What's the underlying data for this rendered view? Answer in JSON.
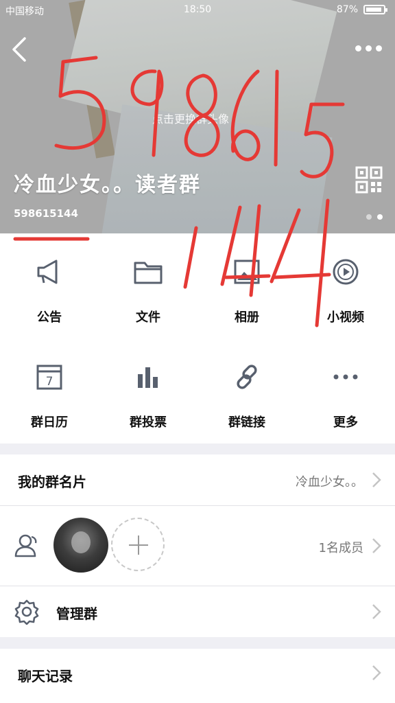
{
  "status_bar": {
    "carrier": "中国移动",
    "time": "18:50",
    "battery": "87%"
  },
  "header": {
    "change_cover": "点击更换群头像",
    "group_name": "冷血少女。。读者群",
    "group_id": "598615144"
  },
  "features": [
    {
      "label": "公告",
      "icon": "megaphone-icon"
    },
    {
      "label": "文件",
      "icon": "folder-icon"
    },
    {
      "label": "相册",
      "icon": "photo-album-icon"
    },
    {
      "label": "小视频",
      "icon": "video-icon"
    },
    {
      "label": "群日历",
      "icon": "calendar-icon",
      "badge": "7"
    },
    {
      "label": "群投票",
      "icon": "bar-chart-icon"
    },
    {
      "label": "群链接",
      "icon": "link-icon"
    },
    {
      "label": "更多",
      "icon": "more-dots-icon"
    }
  ],
  "rows": {
    "my_card": {
      "title": "我的群名片",
      "value": "冷血少女。。"
    },
    "members": {
      "count": "1名成员"
    },
    "manage": {
      "title": "管理群"
    },
    "chat_history": {
      "title": "聊天记录"
    }
  },
  "handwriting": {
    "text": "598615144",
    "color": "#e53935"
  },
  "colors": {
    "icon_gray": "#58606e",
    "chevron": "#c4c4c4"
  }
}
